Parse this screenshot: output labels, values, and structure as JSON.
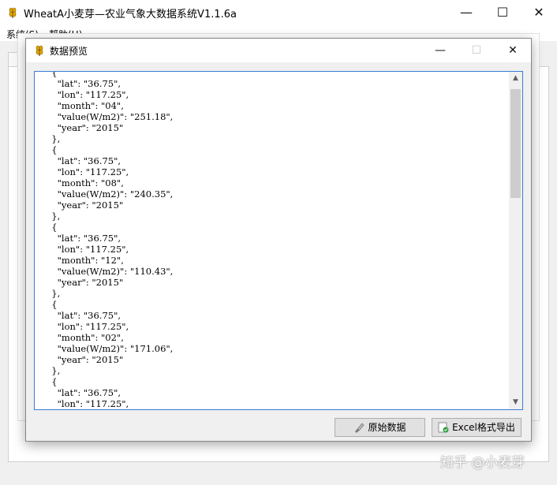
{
  "window": {
    "title": "WheatA小麦芽—农业气象大数据系统V1.1.6a",
    "minimize": "—",
    "maximize": "☐",
    "close": "✕"
  },
  "menu": {
    "items": [
      {
        "label": "系统(S)"
      },
      {
        "label": "帮助(H)"
      }
    ]
  },
  "dialog": {
    "title": "数据预览",
    "minimize": "—",
    "maximize": "☐",
    "close": "✕",
    "content": "  {\n    \"lat\": \"36.75\",\n    \"lon\": \"117.25\",\n    \"month\": \"04\",\n    \"value(W/m2)\": \"251.18\",\n    \"year\": \"2015\"\n  },\n  {\n    \"lat\": \"36.75\",\n    \"lon\": \"117.25\",\n    \"month\": \"08\",\n    \"value(W/m2)\": \"240.35\",\n    \"year\": \"2015\"\n  },\n  {\n    \"lat\": \"36.75\",\n    \"lon\": \"117.25\",\n    \"month\": \"12\",\n    \"value(W/m2)\": \"110.43\",\n    \"year\": \"2015\"\n  },\n  {\n    \"lat\": \"36.75\",\n    \"lon\": \"117.25\",\n    \"month\": \"02\",\n    \"value(W/m2)\": \"171.06\",\n    \"year\": \"2015\"\n  },\n  {\n    \"lat\": \"36.75\",\n    \"lon\": \"117.25\",",
    "scroll_up": "▲",
    "scroll_down": "▼",
    "buttons": {
      "raw_data": "原始数据",
      "excel_export": "Excel格式导出"
    }
  },
  "watermark": "知乎 @小麦芽",
  "colors": {
    "text_border": "#3b7bd6",
    "button_bg": "#e1e1e1"
  },
  "icons": {
    "app": "wheat-icon",
    "raw_data": "brush-icon",
    "excel": "excel-sheet-icon"
  }
}
